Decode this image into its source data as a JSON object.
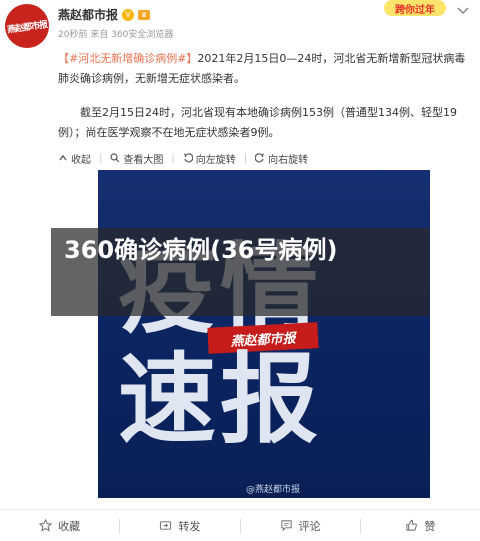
{
  "header": {
    "avatar_text": "燕赵都市报",
    "username": "燕赵都市报",
    "meta": "20秒前 来自 360安全浏览器",
    "promo": "跨你过年"
  },
  "post": {
    "hashtag": "【#河北无新增确诊病例#】",
    "text1": "2021年2月15日0—24时，河北省无新增新型冠状病毒肺炎确诊病例，无新增无症状感染者。",
    "text2": "截至2月15日24时，河北省现有本地确诊病例153例（普通型134例、轻型19例）；尚在医学观察不在地无症状感染者9例。"
  },
  "image_toolbar": {
    "collapse": "收起",
    "view_large": "查看大图",
    "rotate_left": "向左旋转",
    "rotate_right": "向右旋转"
  },
  "image": {
    "line1": "疫情",
    "line2": "速报",
    "stamp": "燕赵都市报",
    "watermark": "@燕赵都市报"
  },
  "overlay": {
    "title": "360确诊病例(36号病例)"
  },
  "actions": {
    "favorite": "收藏",
    "repost": "转发",
    "comment": "评论",
    "like": "赞"
  }
}
